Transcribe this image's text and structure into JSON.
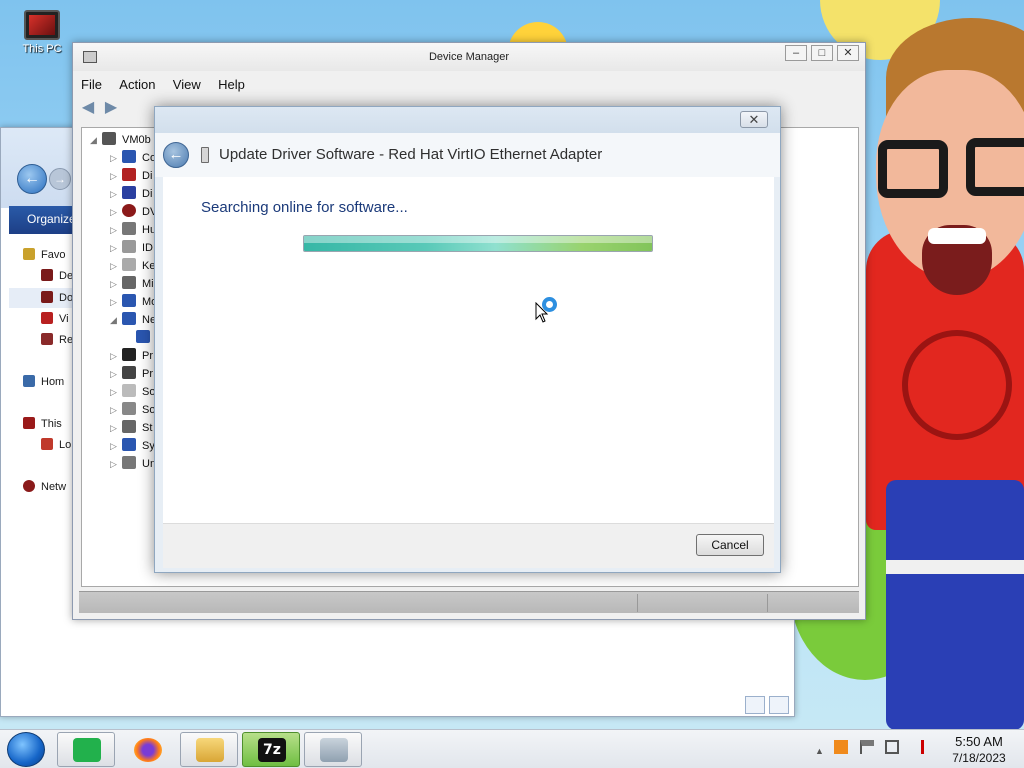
{
  "desktop": {
    "icon_label": "This PC"
  },
  "explorer": {
    "organize_label": "Organize",
    "tree": [
      "Favo",
      "De",
      "Do",
      "Vi",
      "Re",
      "Hom",
      "This",
      "Lo",
      "Netw"
    ]
  },
  "device_manager": {
    "title": "Device Manager",
    "menu": [
      "File",
      "Action",
      "View",
      "Help"
    ],
    "root_node": "VM0b",
    "rows": [
      "Co",
      "Di",
      "Di",
      "DV",
      "Hu",
      "ID",
      "Ke",
      "Mi",
      "Mo",
      "Ne",
      "",
      "Pr",
      "Pr",
      "So",
      "So",
      "St",
      "Sy",
      "Un"
    ]
  },
  "dialog": {
    "title": "Update Driver Software - Red Hat VirtIO Ethernet Adapter",
    "status": "Searching online for software...",
    "progress_fraction": 1.0,
    "cancel_label": "Cancel"
  },
  "taskbar": {
    "time": "5:50 AM",
    "date": "7/18/2023",
    "apps": [
      "messaging-app-icon",
      "firefox-icon",
      "file-explorer-icon",
      "7zip-icon",
      "device-setup-icon"
    ]
  },
  "colors": {
    "accent": "#1b3a7a",
    "progress_start": "#36b7a6",
    "progress_end": "#82c45a"
  }
}
